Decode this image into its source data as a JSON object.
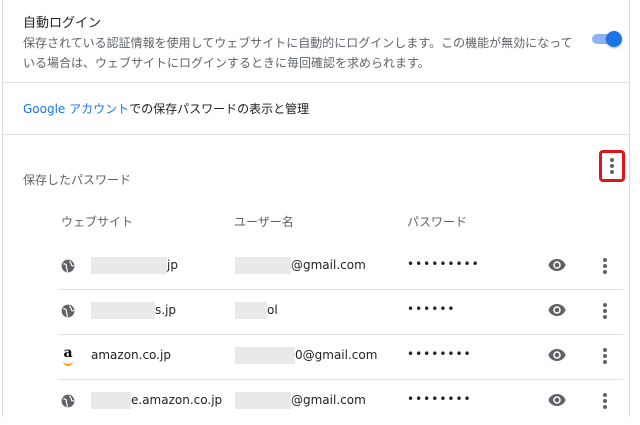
{
  "auto_login": {
    "title": "自動ログイン",
    "description": "保存されている認証情報を使用してウェブサイトに自動的にログインします。この機能が無効になっている場合は、ウェブサイトにログインするときに毎回確認を求められます。",
    "enabled": true
  },
  "manage": {
    "link_text": "Google アカウント",
    "rest_text": "での保存パスワードの表示と管理"
  },
  "saved_passwords": {
    "title": "保存したパスワード",
    "columns": [
      "ウェブサイト",
      "ユーザー名",
      "パスワード"
    ],
    "rows": [
      {
        "icon": "globe-icon",
        "site": "jp",
        "user": "@gmail.com",
        "password": "•••••••••"
      },
      {
        "icon": "globe-icon",
        "site": "s.jp",
        "user": "ol",
        "password": "••••••"
      },
      {
        "icon": "amazon-icon",
        "site": "amazon.co.jp",
        "user": "0@gmail.com",
        "password": "••••••••"
      },
      {
        "icon": "globe-icon",
        "site": "e.amazon.co.jp",
        "user": "@gmail.com",
        "password": "••••••••"
      }
    ]
  },
  "colors": {
    "accent": "#1a73e8",
    "highlight_box": "#e0141b"
  }
}
